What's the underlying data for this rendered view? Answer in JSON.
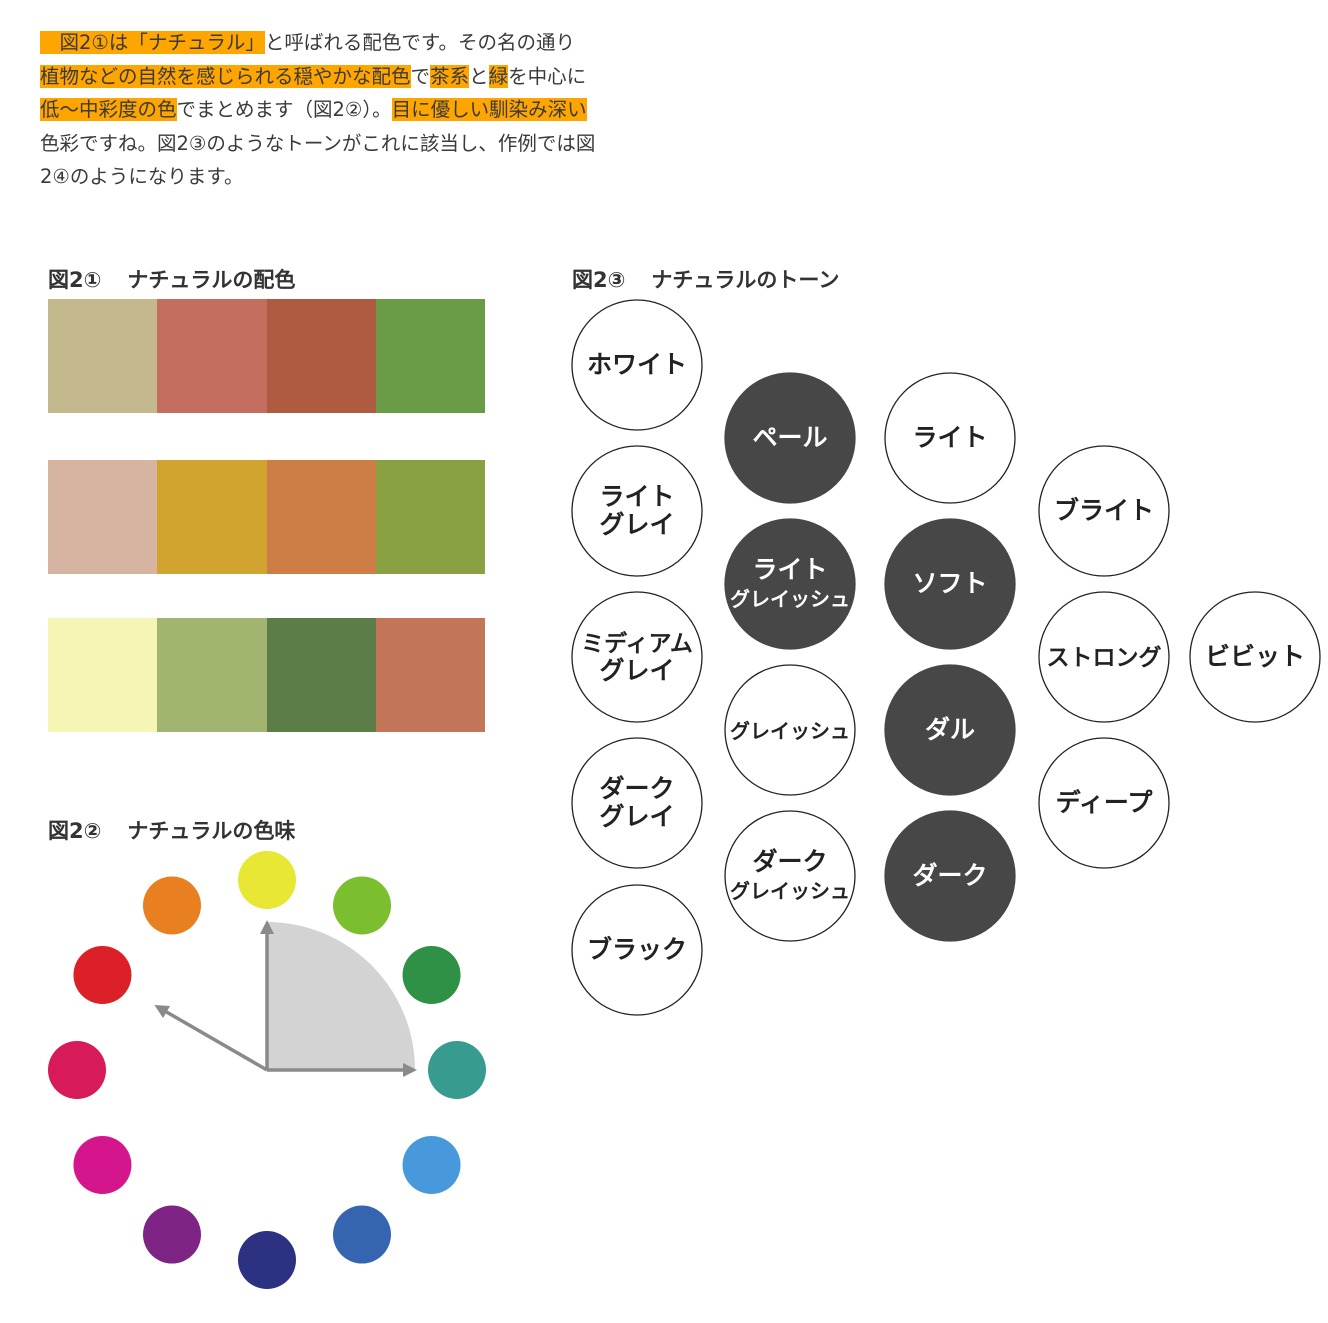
{
  "intro": {
    "line1": [
      {
        "text": "　図2①は「ナチュラル」",
        "hl": true
      },
      {
        "text": "と呼ばれる配色です。その名の通り",
        "hl": false
      }
    ],
    "line2": [
      {
        "text": "植物などの自然を感じられる穏やかな配色",
        "hl": true
      },
      {
        "text": "で",
        "hl": false
      },
      {
        "text": "茶系",
        "hl": true
      },
      {
        "text": "と",
        "hl": false
      },
      {
        "text": "緑",
        "hl": true
      },
      {
        "text": "を中心に",
        "hl": false
      }
    ],
    "line3": [
      {
        "text": "低〜中彩度の色",
        "hl": true
      },
      {
        "text": "でまとめます（図2②）。",
        "hl": false
      },
      {
        "text": "目に優しい馴染み深い",
        "hl": true
      }
    ],
    "line4": [
      {
        "text": "色彩ですね。図2③のようなトーンがこれに該当し、作例では図",
        "hl": false
      }
    ],
    "line5": [
      {
        "text": "2④のようになります。",
        "hl": false
      }
    ]
  },
  "figure1": {
    "number": "図2①",
    "title": "ナチュラルの配色",
    "rows": [
      [
        "#c4b98c",
        "#c36e5e",
        "#ae5b41",
        "#6a9b47"
      ],
      [
        "#d6b4a1",
        "#d1a42f",
        "#cd7e47",
        "#89a142"
      ],
      [
        "#f5f5b6",
        "#a1b570",
        "#5d7d48",
        "#c27557"
      ]
    ]
  },
  "figure2": {
    "number": "図2②",
    "title": "ナチュラルの色味",
    "hue_colors": [
      "#e7e734",
      "#7bbe2e",
      "#2e9146",
      "#389b8f",
      "#4899dc",
      "#3565b1",
      "#2d3182",
      "#7e2484",
      "#d4158b",
      "#d61a5a",
      "#dc2027",
      "#e88021"
    ],
    "highlight_start_hue": 0,
    "highlight_end_hue": 3,
    "outer_arrow_hue": 10
  },
  "figure3": {
    "number": "図2③",
    "title": "ナチュラルのトーン",
    "tones": [
      {
        "label": [
          "ホワイト"
        ],
        "dark": false
      },
      {
        "label": [
          "ライト",
          "グレイ"
        ],
        "dark": false
      },
      {
        "label": [
          "ミディアム",
          "グレイ"
        ],
        "dark": false
      },
      {
        "label": [
          "ダーク",
          "グレイ"
        ],
        "dark": false
      },
      {
        "label": [
          "ブラック"
        ],
        "dark": false
      },
      {
        "label": [
          "ペール"
        ],
        "dark": true
      },
      {
        "label": [
          "ライト",
          "グレイッシュ"
        ],
        "dark": true
      },
      {
        "label": [
          "グレイッシュ"
        ],
        "dark": false
      },
      {
        "label": [
          "ダーク",
          "グレイッシュ"
        ],
        "dark": false
      },
      {
        "label": [
          "ライト"
        ],
        "dark": false
      },
      {
        "label": [
          "ソフト"
        ],
        "dark": true
      },
      {
        "label": [
          "ダル"
        ],
        "dark": true
      },
      {
        "label": [
          "ダーク"
        ],
        "dark": true
      },
      {
        "label": [
          "ブライト"
        ],
        "dark": false
      },
      {
        "label": [
          "ストロング"
        ],
        "dark": false
      },
      {
        "label": [
          "ディープ"
        ],
        "dark": false
      },
      {
        "label": [
          "ビビット"
        ],
        "dark": false
      }
    ]
  },
  "colors": {
    "highlight": "#ffa500",
    "dark_tone": "#474747",
    "circle_stroke": "#222222",
    "arrow": "#8a8a8a",
    "sector_fill": "#d3d3d3"
  }
}
